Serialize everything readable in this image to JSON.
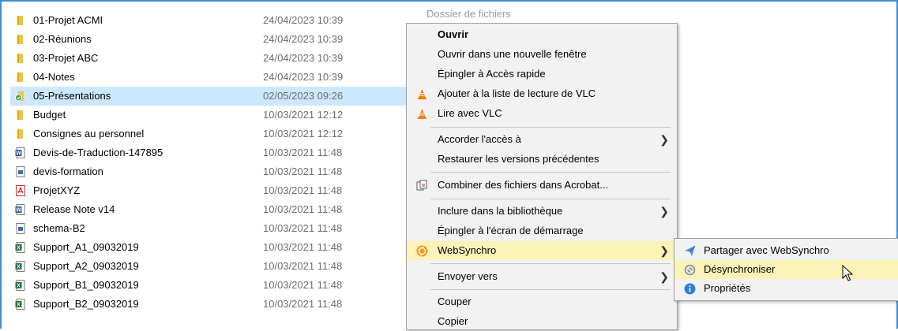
{
  "files": [
    {
      "name": "01-Projet ACMI",
      "date": "24/04/2023 10:39",
      "icon": "folder-icon"
    },
    {
      "name": "02-Réunions",
      "date": "24/04/2023 10:39",
      "icon": "folder-icon"
    },
    {
      "name": "03-Projet ABC",
      "date": "24/04/2023 10:39",
      "icon": "folder-icon"
    },
    {
      "name": "04-Notes",
      "date": "24/04/2023 10:39",
      "icon": "folder-icon"
    },
    {
      "name": "05-Présentations",
      "date": "02/05/2023 09:26",
      "icon": "synced-folder-icon"
    },
    {
      "name": "Budget",
      "date": "10/03/2021 12:12",
      "icon": "folder-icon"
    },
    {
      "name": "Consignes au personnel",
      "date": "10/03/2021 12:12",
      "icon": "folder-icon"
    },
    {
      "name": "Devis-de-Traduction-147895",
      "date": "10/03/2021 11:48",
      "icon": "word-doc-icon"
    },
    {
      "name": "devis-formation",
      "date": "10/03/2021 11:48",
      "icon": "image-file-icon"
    },
    {
      "name": "ProjetXYZ",
      "date": "10/03/2021 11:48",
      "icon": "pdf-icon"
    },
    {
      "name": "Release Note v14",
      "date": "10/03/2021 11:48",
      "icon": "word-doc-icon"
    },
    {
      "name": "schema-B2",
      "date": "10/03/2021 11:48",
      "icon": "image-file-icon"
    },
    {
      "name": "Support_A1_09032019",
      "date": "10/03/2021 11:48",
      "icon": "excel-icon"
    },
    {
      "name": "Support_A2_09032019",
      "date": "10/03/2021 11:48",
      "icon": "excel-icon"
    },
    {
      "name": "Support_B1_09032019",
      "date": "10/03/2021 11:48",
      "icon": "excel-icon"
    },
    {
      "name": "Support_B2_09032019",
      "date": "10/03/2021 11:48",
      "icon": "excel-icon"
    }
  ],
  "type_column_text": "Dossier de fichiers",
  "context_menu": {
    "open": "Ouvrir",
    "open_new_window": "Ouvrir dans une nouvelle fenêtre",
    "pin_quick_access": "Épingler à Accès rapide",
    "vlc_add_playlist": "Ajouter à la liste de lecture de VLC",
    "vlc_play": "Lire avec VLC",
    "grant_access": "Accorder l'accès à",
    "restore_versions": "Restaurer les versions précédentes",
    "acrobat_combine": "Combiner des fichiers dans Acrobat...",
    "include_library": "Inclure dans la bibliothèque",
    "pin_start": "Épingler à l'écran de démarrage",
    "websynchro": "WebSynchro",
    "send_to": "Envoyer vers",
    "cut": "Couper",
    "copy": "Copier"
  },
  "submenu": {
    "share": "Partager avec WebSynchro",
    "unsync": "Désynchroniser",
    "properties": "Propriétés"
  },
  "colors": {
    "selection": "#cce8ff",
    "menu_highlight": "#fbf3b7",
    "folder": "#f5c342",
    "vlc": "#f07f00",
    "websynchro": "#f39a1e"
  }
}
